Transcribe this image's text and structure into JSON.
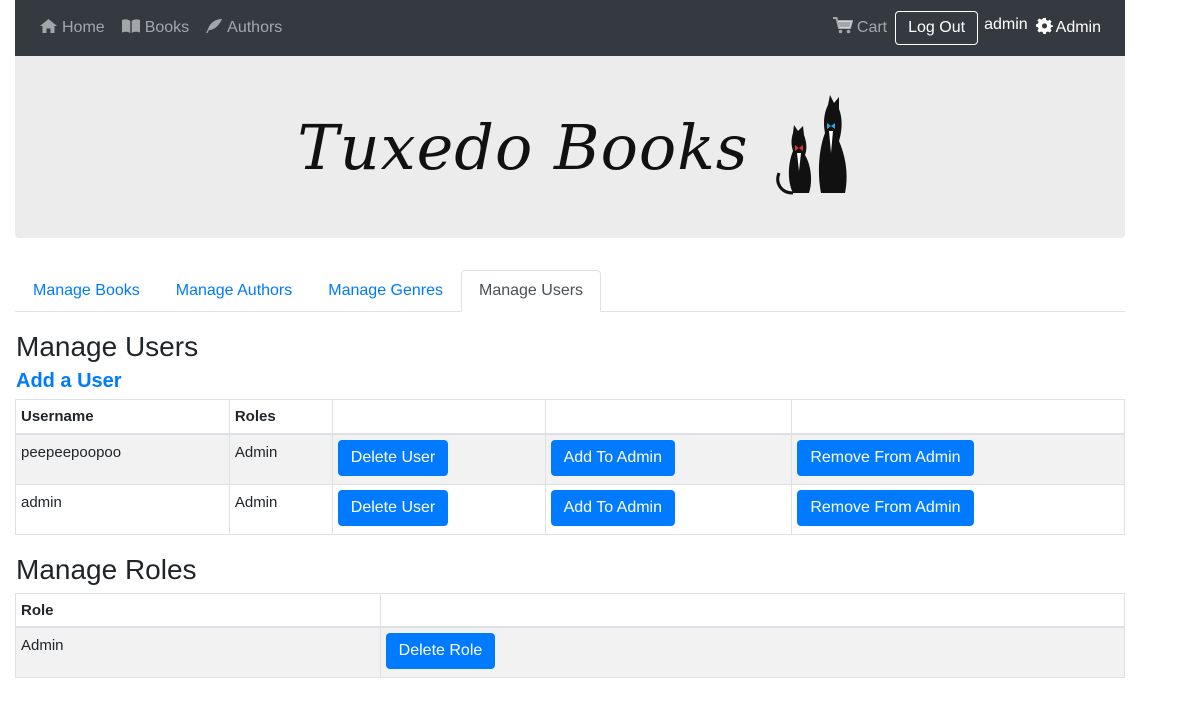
{
  "nav": {
    "home_label": "Home",
    "books_label": "Books",
    "authors_label": "Authors",
    "cart_label": "Cart",
    "logout_label": "Log Out",
    "username": "admin",
    "admin_label": "Admin"
  },
  "banner": {
    "logo_text": "Tuxedo Books"
  },
  "tabs": [
    {
      "label": "Manage Books",
      "active": false
    },
    {
      "label": "Manage Authors",
      "active": false
    },
    {
      "label": "Manage Genres",
      "active": false
    },
    {
      "label": "Manage Users",
      "active": true
    }
  ],
  "users": {
    "title": "Manage Users",
    "add_link": "Add a User",
    "headers": {
      "username": "Username",
      "roles": "Roles"
    },
    "rows": [
      {
        "username": "peepeepoopoo",
        "roles": "Admin",
        "delete": "Delete User",
        "add_admin": "Add To Admin",
        "remove_admin": "Remove From Admin"
      },
      {
        "username": "admin",
        "roles": "Admin",
        "delete": "Delete User",
        "add_admin": "Add To Admin",
        "remove_admin": "Remove From Admin"
      }
    ]
  },
  "roles": {
    "title": "Manage Roles",
    "headers": {
      "role": "Role"
    },
    "rows": [
      {
        "role": "Admin",
        "delete": "Delete Role"
      }
    ]
  },
  "colors": {
    "navbar": "#343a40",
    "primary": "#007bff",
    "banner_bg": "#ececec"
  }
}
